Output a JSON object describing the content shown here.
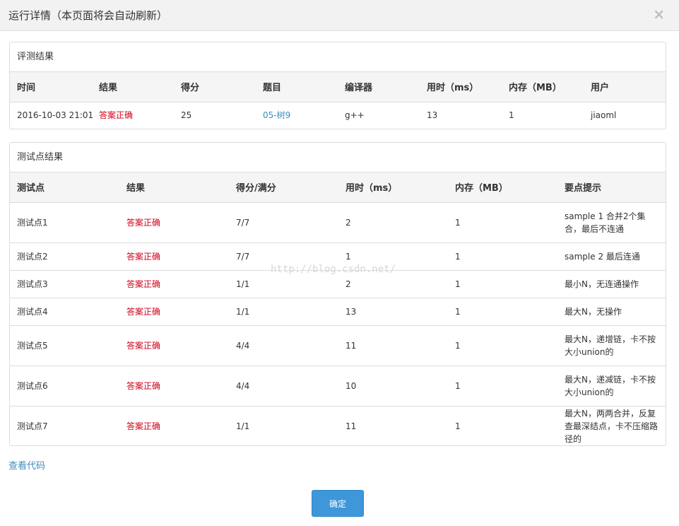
{
  "header": {
    "title": "运行详情（本页面将会自动刷新）",
    "close_glyph": "×"
  },
  "judge": {
    "heading": "评测结果",
    "columns": [
      "时间",
      "结果",
      "得分",
      "题目",
      "编译器",
      "用时（ms）",
      "内存（MB）",
      "用户"
    ],
    "row": {
      "time": "2016-10-03 21:01",
      "result": "答案正确",
      "score": "25",
      "problem": "05-树9",
      "compiler": "g++",
      "time_ms": "13",
      "memory_mb": "1",
      "user": "jiaoml"
    }
  },
  "tests": {
    "heading": "测试点结果",
    "columns": [
      "测试点",
      "结果",
      "得分/满分",
      "用时（ms）",
      "内存（MB）",
      "要点提示"
    ],
    "rows": [
      {
        "name": "测试点1",
        "result": "答案正确",
        "score": "7/7",
        "time": "2",
        "memory": "1",
        "hint": "sample 1 合并2个集合，最后不连通"
      },
      {
        "name": "测试点2",
        "result": "答案正确",
        "score": "7/7",
        "time": "1",
        "memory": "1",
        "hint": "sample 2 最后连通"
      },
      {
        "name": "测试点3",
        "result": "答案正确",
        "score": "1/1",
        "time": "2",
        "memory": "1",
        "hint": "最小N，无连通操作"
      },
      {
        "name": "测试点4",
        "result": "答案正确",
        "score": "1/1",
        "time": "13",
        "memory": "1",
        "hint": "最大N，无操作"
      },
      {
        "name": "测试点5",
        "result": "答案正确",
        "score": "4/4",
        "time": "11",
        "memory": "1",
        "hint": "最大N，递增链，卡不按大小union的"
      },
      {
        "name": "测试点6",
        "result": "答案正确",
        "score": "4/4",
        "time": "10",
        "memory": "1",
        "hint": "最大N，递减链，卡不按大小union的"
      },
      {
        "name": "测试点7",
        "result": "答案正确",
        "score": "1/1",
        "time": "11",
        "memory": "1",
        "hint": "最大N，两两合并，反复查最深结点，卡不压缩路径的"
      }
    ]
  },
  "footer": {
    "view_code": "查看代码",
    "ok_label": "确定"
  },
  "watermark": "http://blog.csdn.net/",
  "colors": {
    "accent": "#3e97d9",
    "link": "#3c8dbc",
    "success_text": "#d0021b",
    "header_bg": "#f2f2f2"
  }
}
